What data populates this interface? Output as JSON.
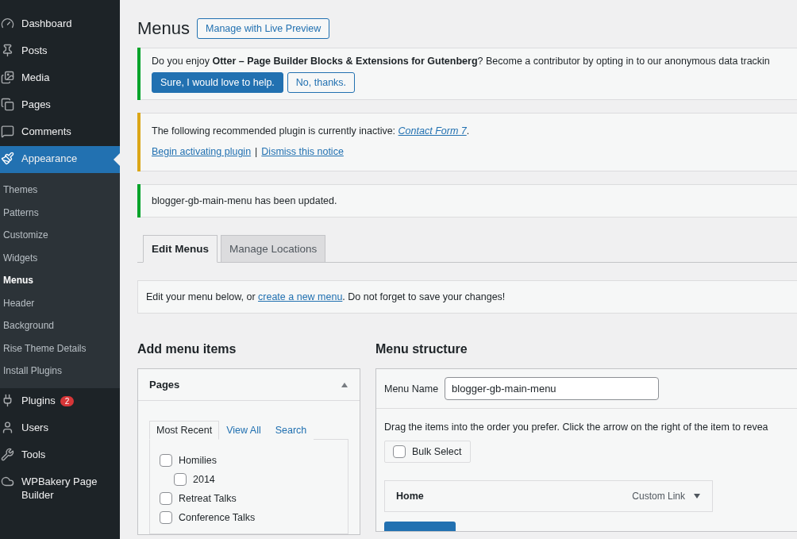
{
  "sidebar": {
    "items": [
      {
        "label": "Dashboard",
        "selected": false
      },
      {
        "label": "Posts",
        "selected": false
      },
      {
        "label": "Media",
        "selected": false
      },
      {
        "label": "Pages",
        "selected": false
      },
      {
        "label": "Comments",
        "selected": false
      },
      {
        "label": "Appearance",
        "selected": true,
        "children": [
          {
            "label": "Themes",
            "selected": false
          },
          {
            "label": "Patterns",
            "selected": false
          },
          {
            "label": "Customize",
            "selected": false
          },
          {
            "label": "Widgets",
            "selected": false
          },
          {
            "label": "Menus",
            "selected": true
          },
          {
            "label": "Header",
            "selected": false
          },
          {
            "label": "Background",
            "selected": false
          },
          {
            "label": "Rise Theme Details",
            "selected": false
          },
          {
            "label": "Install Plugins",
            "selected": false
          }
        ]
      },
      {
        "label": "Plugins",
        "selected": false,
        "badge": "2"
      },
      {
        "label": "Users",
        "selected": false
      },
      {
        "label": "Tools",
        "selected": false
      },
      {
        "label": "WPBakery Page Builder",
        "selected": false
      }
    ]
  },
  "page": {
    "title": "Menus",
    "title_button": "Manage with Live Preview"
  },
  "notices": [
    {
      "kind": "optin",
      "color": "#00a32a",
      "text": "Do you enjoy **Otter – Page Builder Blocks & Extensions for Gutenberg**? Become a contributor by opting in to our anonymous data trackin",
      "buttons": [
        {
          "label": "Sure, I would love to help.",
          "primary": true
        },
        {
          "label": "No, thanks.",
          "primary": false
        }
      ]
    },
    {
      "kind": "plugin",
      "color": "#dba617",
      "text_before": "The following recommended plugin is currently inactive: ",
      "link": "Contact Form 7",
      "text_after": ".",
      "links": [
        "Begin activating plugin",
        "Dismiss this notice"
      ],
      "separator": "|"
    },
    {
      "kind": "updated",
      "color": "#00a32a",
      "text": "blogger-gb-main-menu has been updated."
    }
  ],
  "tabs": [
    {
      "label": "Edit Menus",
      "selected": true
    },
    {
      "label": "Manage Locations",
      "selected": false
    }
  ],
  "description": {
    "before": "Edit your menu below, or ",
    "link": "create a new menu",
    "after": ". Do not forget to save your changes!"
  },
  "add_items": {
    "heading": "Add menu items",
    "panel": {
      "title": "Pages",
      "expanded": true,
      "tabs": [
        {
          "label": "Most Recent",
          "selected": true
        },
        {
          "label": "View All",
          "selected": false
        },
        {
          "label": "Search",
          "selected": false
        }
      ],
      "pages": [
        {
          "label": "Homilies",
          "checked": false,
          "children": [
            {
              "label": "2014",
              "checked": false
            }
          ]
        },
        {
          "label": "Retreat Talks",
          "checked": false
        },
        {
          "label": "Conference Talks",
          "checked": false
        }
      ]
    }
  },
  "structure": {
    "heading": "Menu structure",
    "name_label": "Menu Name",
    "name_value": "blogger-gb-main-menu",
    "hint": "Drag the items into the order you prefer. Click the arrow on the right of the item to revea",
    "bulk_select": {
      "label": "Bulk Select",
      "checked": false
    },
    "items": [
      {
        "title": "Home",
        "type": "Custom Link",
        "expanded": false
      }
    ]
  }
}
